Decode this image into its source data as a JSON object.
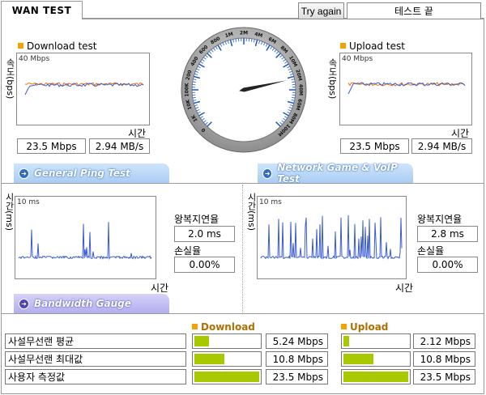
{
  "header": {
    "tab_label": "WAN TEST",
    "try_again_label": "Try again",
    "status_text": "테스트 끝"
  },
  "download": {
    "title": "Download test",
    "y_axis_label": "속도(bps)",
    "unit": "40 Mbps",
    "x_axis_label": "시간",
    "mbps": "23.5 Mbps",
    "mbs": "2.94 MB/s"
  },
  "upload": {
    "title": "Upload test",
    "y_axis_label": "속도(bps)",
    "unit": "40 Mbps",
    "x_axis_label": "시간",
    "mbps": "23.5 Mbps",
    "mbs": "2.94 MB/s"
  },
  "gauge": {
    "labels": [
      "0",
      "1K",
      "10K",
      "100K",
      "200",
      "400",
      "600",
      "800",
      "1M",
      "2M",
      "4M",
      "6M",
      "8M",
      "10M",
      "20M",
      "40M",
      "60M",
      "80M",
      "100M"
    ],
    "needle_value": "23.5 Mbps"
  },
  "sections": {
    "general_ping": "General Ping Test",
    "network_game": "Network Game & VoIP Test",
    "bandwidth": "Bandwidth Gauge"
  },
  "ping_general": {
    "y_axis_label": "시간(ms)",
    "unit": "10 ms",
    "x_axis_label": "시간",
    "rtt_label": "왕복지연율",
    "rtt_value": "2.0 ms",
    "loss_label": "손실율",
    "loss_value": "0.00%"
  },
  "ping_game": {
    "y_axis_label": "시간(ms)",
    "unit": "10 ms",
    "x_axis_label": "시간",
    "rtt_label": "왕복지연율",
    "rtt_value": "2.8 ms",
    "loss_label": "손실율",
    "loss_value": "0.00%"
  },
  "bandwidth": {
    "download_label": "Download",
    "upload_label": "Upload",
    "rows": [
      {
        "label": "사설무선랜 평균",
        "down_value": "5.24 Mbps",
        "down_frac": 0.22,
        "up_value": "2.12 Mbps",
        "up_frac": 0.09
      },
      {
        "label": "사설무선랜 최대값",
        "down_value": "10.8 Mbps",
        "down_frac": 0.46,
        "up_value": "10.8 Mbps",
        "up_frac": 0.46
      },
      {
        "label": "사용자 측정값",
        "down_value": "23.5 Mbps",
        "down_frac": 1.0,
        "up_value": "23.5 Mbps",
        "up_frac": 1.0
      }
    ]
  },
  "colors": {
    "down_line": "#f07000",
    "up_line": "#3a5bd0",
    "ping_line": "#3a5bd0",
    "bar_fill": "#a8c800",
    "legend_square": "#f4a200"
  }
}
